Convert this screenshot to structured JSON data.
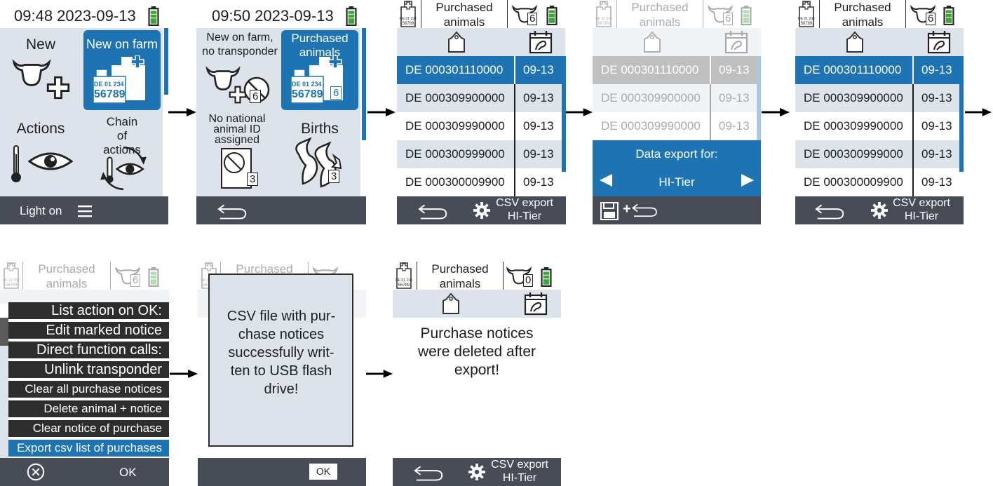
{
  "screen1": {
    "time": "09:48 2023-09-13",
    "tiles": [
      "New",
      "New on farm",
      "Actions",
      "Chain of actions"
    ],
    "tag_text1": "DE 01 234",
    "tag_text2": "56789",
    "bottom": "Light on"
  },
  "screen2": {
    "time": "09:50 2023-09-13",
    "tiles": [
      "New on farm, no transponder",
      "Purchased animals",
      "No national animal ID assigned",
      "Births"
    ],
    "counts": [
      "6",
      "6",
      "3",
      "3"
    ],
    "tag_text1": "DE 01 234",
    "tag_text2": "56789"
  },
  "list": {
    "title": "Purchased animals",
    "count": "6",
    "rows": [
      {
        "id": "DE 000301110000",
        "date": "09-13"
      },
      {
        "id": "DE 000309900000",
        "date": "09-13"
      },
      {
        "id": "DE 000309990000",
        "date": "09-13"
      },
      {
        "id": "DE 000300999000",
        "date": "09-13"
      },
      {
        "id": "DE 000300009900",
        "date": "09-13"
      }
    ],
    "csv_label": "CSV export",
    "csv_sub": "HI-Tier"
  },
  "export_dialog": {
    "label": "Data export for:",
    "value": "HI-Tier"
  },
  "menu": {
    "items": [
      "List action on OK:",
      "Edit marked notice",
      "Direct function calls:",
      "Unlink transponder",
      "Clear all purchase notices",
      "Delete animal + notice",
      "Clear notice of purchase",
      "Export csv list of purchases"
    ],
    "ok": "OK"
  },
  "success": {
    "message": "CSV file with pur-chase  notices successfully writ-ten to USB flash drive!",
    "ok": "OK"
  },
  "deleted": {
    "count": "0",
    "message": "Purchase notices were deleted after export!"
  },
  "icons": [
    "battery-icon",
    "cow-plus-icon",
    "ear-tag-icon",
    "cow-head-icon",
    "calendar-icon",
    "thermometer-icon",
    "eye-icon",
    "cycle-icon",
    "stork-icon",
    "back-icon",
    "gear-icon",
    "menu-icon",
    "save-icon",
    "close-circle-icon",
    "arrow-right-icon"
  ],
  "colors": {
    "accent": "#1e73b2",
    "bar": "#474c57",
    "panel": "#dde3ea"
  }
}
